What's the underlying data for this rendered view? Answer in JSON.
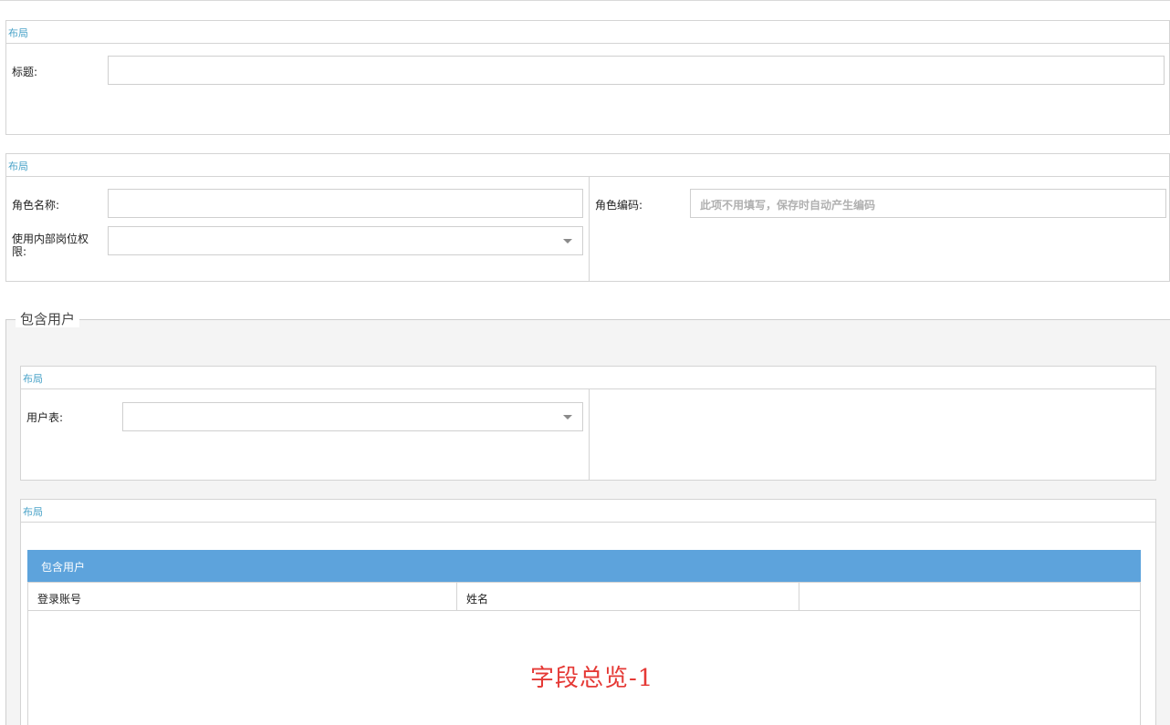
{
  "layout_label": "布局",
  "title_section": {
    "title_label": "标题:",
    "title_value": ""
  },
  "role_section": {
    "role_name_label": "角色名称:",
    "role_name_value": "",
    "internal_permission_label": "使用内部岗位权限:",
    "internal_permission_value": "",
    "role_code_label": "角色编码:",
    "role_code_placeholder": "此项不用填写，保存时自动产生编码"
  },
  "users_fieldset": {
    "legend": "包含用户",
    "user_table_label": "用户表:",
    "user_table_value": "",
    "grid": {
      "title": "包含用户",
      "columns": [
        "登录账号",
        "姓名",
        ""
      ],
      "rows": [],
      "overlay_text": "字段总览-1"
    }
  },
  "colors": {
    "accent": "#5da3dc",
    "layout_title": "#4aa3c8",
    "overlay": "#e53935"
  }
}
